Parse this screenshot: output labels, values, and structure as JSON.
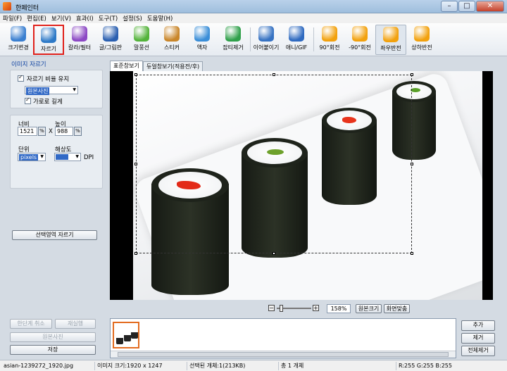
{
  "window": {
    "title": "한페인터",
    "minimize": "–",
    "maximize": "□",
    "close": "✕"
  },
  "menu": [
    "파일(F)",
    "편집(E)",
    "보기(V)",
    "효과(I)",
    "도구(T)",
    "설정(S)",
    "도움말(H)"
  ],
  "toolbar": [
    {
      "label": "크기변경",
      "icon": "resize-icon",
      "color": "#3a7fd0"
    },
    {
      "label": "자르기",
      "icon": "crop-icon",
      "color": "#2d79c7"
    },
    {
      "label": "칼라/필터",
      "icon": "color-filter-icon",
      "color": "#8c48c4"
    },
    {
      "label": "글/그림판",
      "icon": "text-paint-icon",
      "color": "#2a5fb0"
    },
    {
      "label": "말풍선",
      "icon": "speech-bubble-icon",
      "color": "#53b33a"
    },
    {
      "label": "스티커",
      "icon": "sticker-icon",
      "color": "#c9862a"
    },
    {
      "label": "액자",
      "icon": "frame-icon",
      "color": "#3a8ed8"
    },
    {
      "label": "잡티제거",
      "icon": "blemish-remove-icon",
      "color": "#2fa04a"
    },
    {
      "label": "이어붙이기",
      "icon": "merge-icon",
      "color": "#3672c2"
    },
    {
      "label": "애니/GIF",
      "icon": "animation-gif-icon",
      "color": "#2f6ac0"
    },
    {
      "label": "90°회전",
      "icon": "rotate-right-icon",
      "color": "#f2a10d"
    },
    {
      "label": "-90°회전",
      "icon": "rotate-left-icon",
      "color": "#f2a10d"
    },
    {
      "label": "좌우반전",
      "icon": "flip-horizontal-icon",
      "color": "#f2a10d"
    },
    {
      "label": "상하반전",
      "icon": "flip-vertical-icon",
      "color": "#f2a10d"
    }
  ],
  "left": {
    "section_title": "이미지 자르기",
    "keep_ratio_label": "자르기 비율 유지",
    "ratio_value": "원본사진",
    "landscape_label": "가로로 길게",
    "width_label": "너비",
    "height_label": "높이",
    "width_value": "1521",
    "x_label": "X",
    "height_value": "988",
    "unit_label": "단위",
    "unit_value": "pixels",
    "resolution_label": "해상도",
    "resolution_value": "",
    "dpi_label": "DPI",
    "crop_button": "선택영역 자르기",
    "undo_button": "한단계 취소",
    "redo_button": "재실행",
    "original_button": "원본사진",
    "save_button": "저장"
  },
  "tabs": [
    "표준창보기",
    "듀얼창보기(적용전/후)"
  ],
  "zoom": {
    "minus": "−",
    "plus": "+",
    "value": "158%",
    "original_size": "원본크기",
    "fit_screen": "화면맞춤"
  },
  "right_buttons": {
    "add": "추가",
    "remove": "제거",
    "remove_all": "전체제거"
  },
  "status": {
    "file": "asian-1239272_1920.jpg",
    "image_size": "이미지 크기:1920 x 1247",
    "selected": "선택된 개체:1(213KB)",
    "total": "총 1 개체",
    "rgb": "R:255 G:255 B:255"
  },
  "colors": {
    "selection_highlight": "#e0201a",
    "thumb_border": "#e36b1f",
    "accent": "#3169c6"
  }
}
